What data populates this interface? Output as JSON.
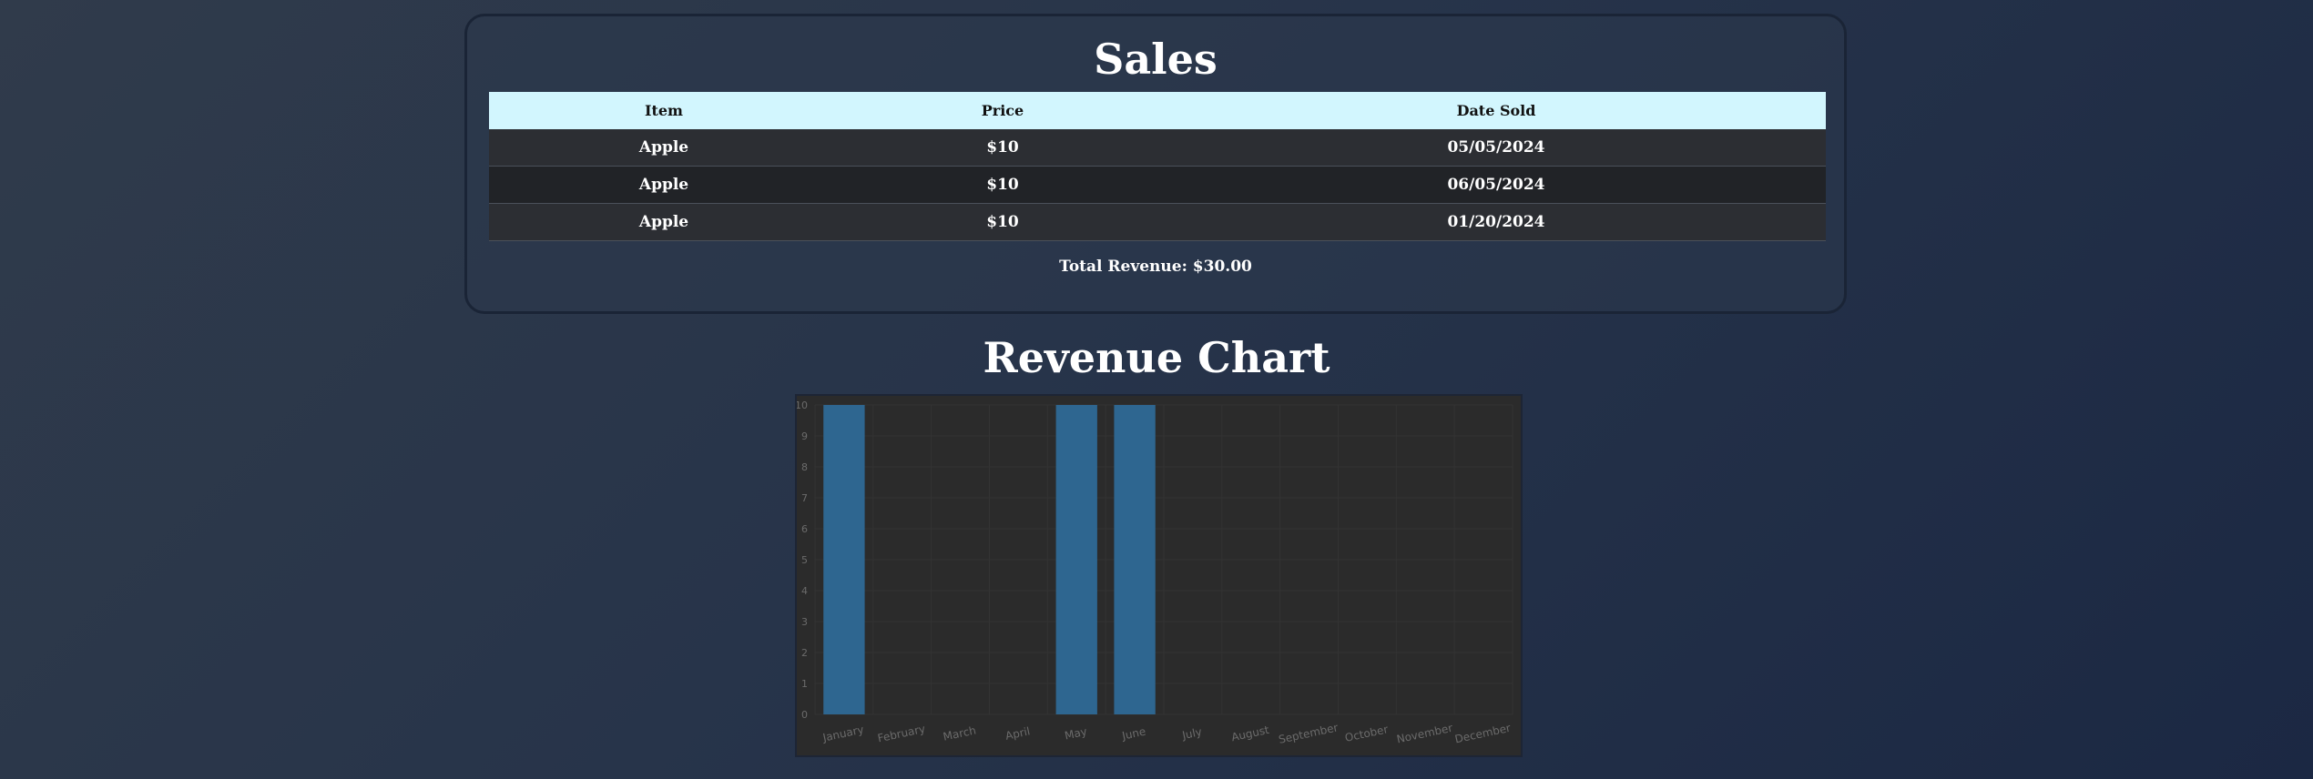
{
  "sales": {
    "title": "Sales",
    "columns": [
      "Item",
      "Price",
      "Date Sold"
    ],
    "rows": [
      [
        "Apple",
        "$10",
        "05/05/2024"
      ],
      [
        "Apple",
        "$10",
        "06/05/2024"
      ],
      [
        "Apple",
        "$10",
        "01/20/2024"
      ]
    ],
    "total_revenue": "Total Revenue: $30.00"
  },
  "chart_title": "Revenue Chart",
  "chart_data": {
    "type": "bar",
    "title": "",
    "xlabel": "",
    "ylabel": "",
    "categories": [
      "January",
      "February",
      "March",
      "April",
      "May",
      "June",
      "July",
      "August",
      "September",
      "October",
      "November",
      "December"
    ],
    "values": [
      10,
      0,
      0,
      0,
      10,
      10,
      0,
      0,
      0,
      0,
      0,
      0
    ],
    "ylim": [
      0,
      10
    ],
    "yticks": [
      0,
      1,
      2,
      3,
      4,
      5,
      6,
      7,
      8,
      9,
      10
    ],
    "grid": true,
    "legend": "none",
    "bar_color": "#2e6690"
  },
  "colors": {
    "header_bg": "#d2f6fe",
    "row_odd": "#2c2e33",
    "row_even": "#212327",
    "chart_bg": "#2b2b2b",
    "bar": "#2e6690"
  }
}
